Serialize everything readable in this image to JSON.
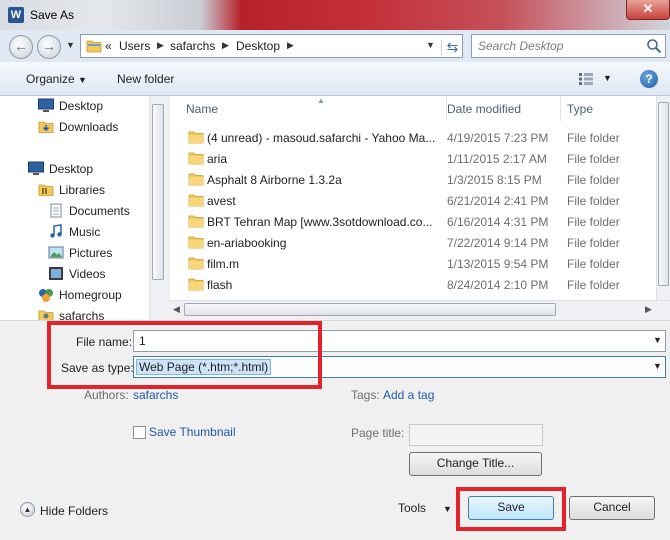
{
  "window": {
    "title": "Save As",
    "app_icon_letter": "W"
  },
  "breadcrumb": [
    "Users",
    "safarchs",
    "Desktop"
  ],
  "breadcrumb_overflow": "«",
  "search": {
    "placeholder": "Search Desktop"
  },
  "toolbar": {
    "organize": "Organize",
    "new_folder": "New folder"
  },
  "nav_pane": [
    {
      "label": "Desktop",
      "icon": "desktop-icon",
      "level": 1
    },
    {
      "label": "Downloads",
      "icon": "downloads-folder-icon",
      "level": 1
    },
    {
      "label": "Desktop",
      "icon": "desktop-icon",
      "level": 0
    },
    {
      "label": "Libraries",
      "icon": "libraries-icon",
      "level": 1
    },
    {
      "label": "Documents",
      "icon": "documents-icon",
      "level": 2
    },
    {
      "label": "Music",
      "icon": "music-icon",
      "level": 2
    },
    {
      "label": "Pictures",
      "icon": "pictures-icon",
      "level": 2
    },
    {
      "label": "Videos",
      "icon": "videos-icon",
      "level": 2
    },
    {
      "label": "Homegroup",
      "icon": "homegroup-icon",
      "level": 1
    },
    {
      "label": "safarchs",
      "icon": "user-icon",
      "level": 1
    }
  ],
  "columns": {
    "name": "Name",
    "date": "Date modified",
    "type": "Type"
  },
  "files": [
    {
      "name": "(4 unread) - masoud.safarchi - Yahoo Ma...",
      "date": "4/19/2015 7:23 PM",
      "type": "File folder"
    },
    {
      "name": "aria",
      "date": "1/11/2015 2:17 AM",
      "type": "File folder"
    },
    {
      "name": "Asphalt 8 Airborne 1.3.2a",
      "date": "1/3/2015 8:15 PM",
      "type": "File folder"
    },
    {
      "name": "avest",
      "date": "6/21/2014 2:41 PM",
      "type": "File folder"
    },
    {
      "name": "BRT Tehran Map [www.3sotdownload.co...",
      "date": "6/16/2014 4:31 PM",
      "type": "File folder"
    },
    {
      "name": "en-ariabooking",
      "date": "7/22/2014 9:14 PM",
      "type": "File folder"
    },
    {
      "name": "film.m",
      "date": "1/13/2015 9:54 PM",
      "type": "File folder"
    },
    {
      "name": "flash",
      "date": "8/24/2014 2:10 PM",
      "type": "File folder"
    }
  ],
  "form": {
    "file_name_label": "File name:",
    "file_name_value": "1",
    "save_type_label": "Save as type:",
    "save_type_value": "Web Page (*.htm;*.html)",
    "authors_label": "Authors:",
    "authors_value": "safarchs",
    "tags_label": "Tags:",
    "tags_value": "Add a tag",
    "save_thumbnail": "Save Thumbnail",
    "page_title_label": "Page title:",
    "change_title": "Change Title..."
  },
  "footer": {
    "hide_folders": "Hide Folders",
    "tools": "Tools",
    "save": "Save",
    "cancel": "Cancel"
  },
  "colors": {
    "highlight_red": "#e2232b",
    "link_blue": "#1f5aa8",
    "folder_yellow": "#f3c95a"
  }
}
